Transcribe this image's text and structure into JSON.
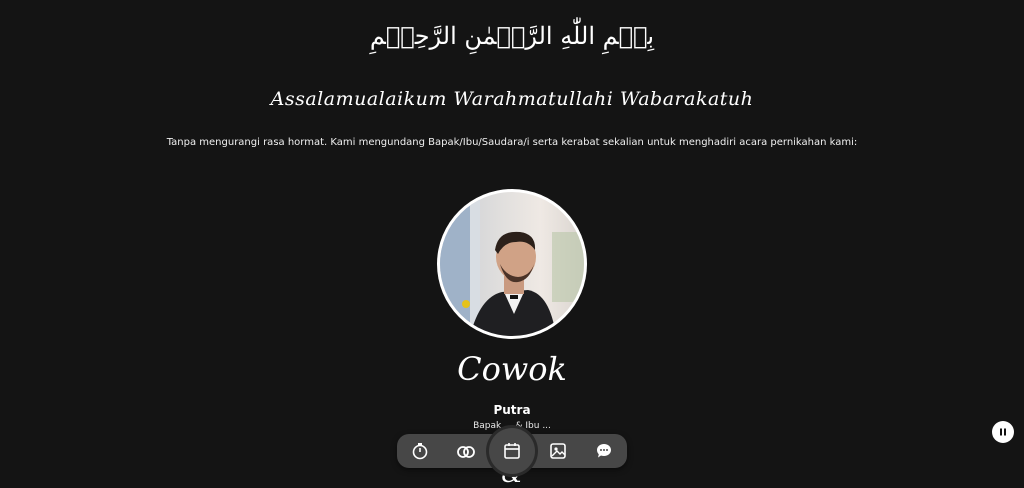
{
  "header": {
    "bismillah": "بِسۡمِ اللّٰهِ الرَّحۡمٰنِ الرَّحِيۡمِ",
    "greeting": "Assalamualaikum Warahmatullahi Wabarakatuh",
    "intro": "Tanpa mengurangi rasa hormat. Kami mengundang Bapak/Ibu/Saudara/i serta kerabat sekalian untuk menghadiri acara pernikahan kami:"
  },
  "groom": {
    "nickname": "Cowok",
    "full_name": "Putra",
    "parents": "Bapak ... & Ibu ..."
  },
  "separator": "&",
  "bottom_nav": {
    "items": [
      {
        "name": "countdown",
        "icon": "stopwatch-icon"
      },
      {
        "name": "couple",
        "icon": "rings-icon"
      },
      {
        "name": "event",
        "icon": "calendar-icon",
        "active": true
      },
      {
        "name": "gallery",
        "icon": "image-icon"
      },
      {
        "name": "wishes",
        "icon": "chat-icon"
      }
    ]
  },
  "music_toggle": {
    "icon": "pause-icon"
  },
  "colors": {
    "background": "#141414",
    "nav": "#474747",
    "text": "#ffffff"
  }
}
